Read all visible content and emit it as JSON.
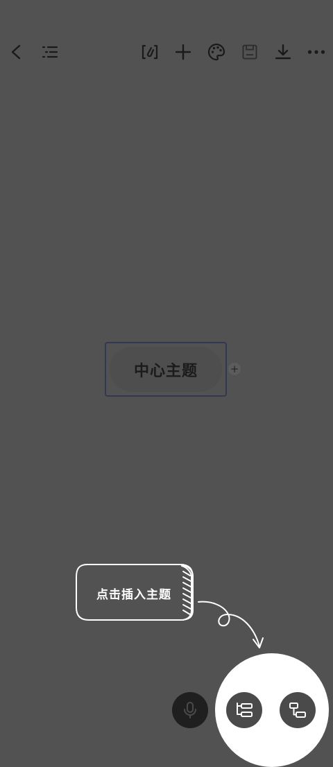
{
  "toolbar": {
    "left": [
      {
        "name": "back-icon"
      },
      {
        "name": "outline-icon"
      }
    ],
    "right": [
      {
        "name": "attachment-icon"
      },
      {
        "name": "add-icon"
      },
      {
        "name": "palette-icon"
      },
      {
        "name": "save-icon"
      },
      {
        "name": "download-icon"
      },
      {
        "name": "more-icon"
      }
    ]
  },
  "canvas": {
    "central_topic": "中心主题",
    "add_child": "+"
  },
  "hint": {
    "text": "点击插入主题"
  },
  "bottom_actions": [
    {
      "name": "microphone-icon"
    },
    {
      "name": "insert-sibling-topic-icon"
    },
    {
      "name": "insert-child-topic-icon"
    }
  ],
  "colors": {
    "background": "#525252",
    "icon": "#1a1a1a",
    "topic_border": "#323850",
    "spotlight": "#ffffff"
  }
}
